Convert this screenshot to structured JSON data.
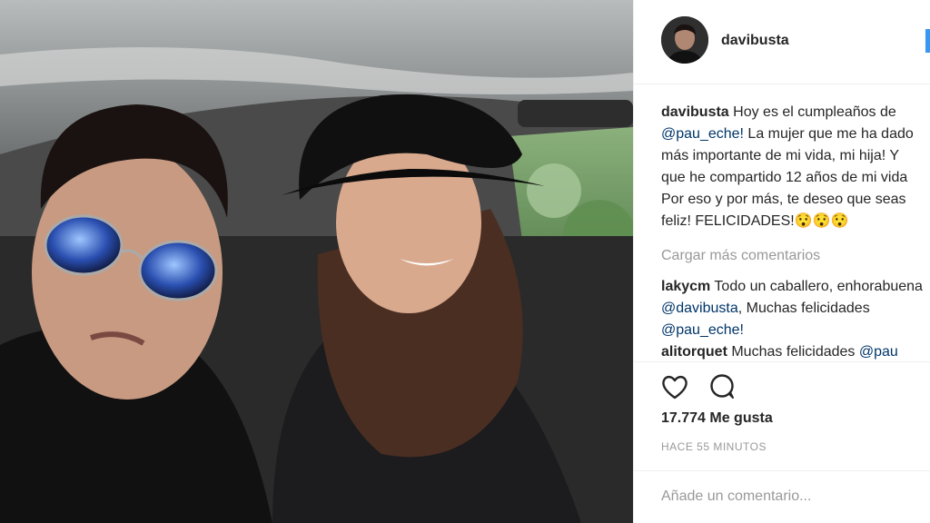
{
  "post": {
    "author": "davibusta",
    "photo_alt": "car selfie",
    "caption": {
      "user": "davibusta",
      "line1": "Hoy es el cumpleaños de",
      "mention": "@pau_eche!",
      "line2_rest": " La mujer que me ha dado",
      "line3": "más importante de mi vida, mi hija! Y",
      "line4": "que he compartido 12 años de mi vida",
      "line5": "Por eso y por más, te deseo que seas",
      "line6": "feliz! FELICIDADES!😯😯😯"
    },
    "load_more": "Cargar más comentarios",
    "comments": [
      {
        "user": "lakycm",
        "text1": "Todo un caballero, enhorabuena",
        "mention1": "@davibusta",
        "text2": ", Muchas felicidades",
        "mention2": "@pau_eche!"
      },
      {
        "user": "alitorquet",
        "text1": "Muchas felicidades",
        "mention1": "@pau"
      }
    ],
    "likes": "17.774 Me gusta",
    "time_ago": "HACE 55 MINUTOS",
    "add_comment_placeholder": "Añade un comentario...",
    "icons": {
      "like": "heart-icon",
      "comment": "comment-bubble-icon"
    },
    "colors": {
      "mention": "#003569",
      "muted": "#999999",
      "text": "#262626",
      "follow": "#3897f0"
    }
  }
}
